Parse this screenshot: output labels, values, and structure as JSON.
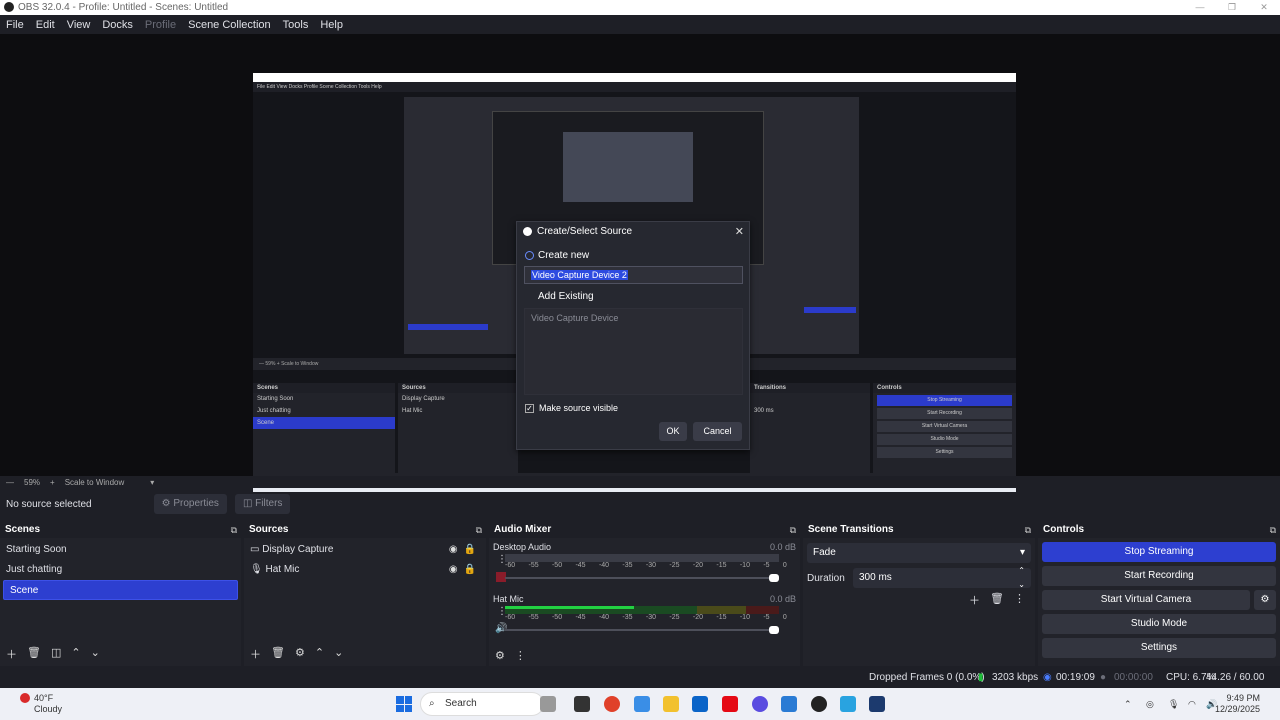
{
  "window": {
    "title": "OBS 32.0.4 - Profile: Untitled - Scenes: Untitled",
    "controls": [
      "—",
      "❐",
      "✕"
    ]
  },
  "menubar": {
    "items": [
      "File",
      "Edit",
      "View",
      "Docks",
      "Profile",
      "Scene Collection",
      "Tools",
      "Help"
    ]
  },
  "preview_nested": {
    "menu": "File  Edit  View  Docks  Profile  Scene Collection  Tools  Help",
    "zoom_row": "—  59%  +  Scale to Window",
    "no_source": "No source selected",
    "properties": "Properties",
    "filters": "Filters",
    "scenes_header": "Scenes",
    "scenes": [
      "Starting Soon",
      "Just chatting",
      "Scene"
    ],
    "sources_header": "Sources",
    "sources": [
      "Display Capture",
      "Hat Mic"
    ],
    "transitions_header": "Transitions",
    "duration": "300 ms",
    "controls_header": "Controls",
    "controls": [
      "Stop Streaming",
      "Start Recording",
      "Start Virtual Camera",
      "Studio Mode",
      "Settings"
    ],
    "status": "Dropped Frames 0 (0.0%)   3203 kbps   00:19:09   00:00:00   CPU: 6.7%   44.26 / 60.00 FPS",
    "nested_dialog_items": [
      "Create/Select Source",
      "Create new",
      "Video Capture Device 2",
      "Add Existing"
    ]
  },
  "dialog": {
    "title": "Create/Select Source",
    "close": "✕",
    "create_new": "Create new",
    "name_value": "Video Capture Device 2",
    "add_existing": "Add Existing",
    "existing_items": [
      "Video Capture Device"
    ],
    "make_visible": "Make source visible",
    "ok": "OK",
    "cancel": "Cancel"
  },
  "zoombar": {
    "minus": "—",
    "zoom": "59%",
    "plus": "+",
    "scale": "Scale to Window"
  },
  "context": {
    "status": "No source selected",
    "properties": "Properties",
    "filters": "Filters"
  },
  "scenes": {
    "header": "Scenes",
    "items": [
      "Starting Soon",
      "Just chatting",
      "Scene"
    ],
    "selected_index": 2
  },
  "sources": {
    "header": "Sources",
    "items": [
      {
        "label": "Display Capture",
        "icon": "monitor-icon"
      },
      {
        "label": "Hat Mic",
        "icon": "mic-icon"
      }
    ]
  },
  "audio_mixer": {
    "header": "Audio Mixer",
    "channels": [
      {
        "name": "Desktop Audio",
        "db": "0.0 dB",
        "level_percent": 0,
        "fader_percent": 100,
        "muted": true
      },
      {
        "name": "Hat Mic",
        "db": "0.0 dB",
        "level_percent": 47,
        "fader_percent": 100,
        "muted": false
      }
    ],
    "ticks": [
      "-60",
      "-55",
      "-50",
      "-45",
      "-40",
      "-35",
      "-30",
      "-25",
      "-20",
      "-15",
      "-10",
      "-5",
      "0"
    ]
  },
  "transitions": {
    "header": "Scene Transitions",
    "selected": "Fade",
    "duration_label": "Duration",
    "duration_value": "300 ms"
  },
  "controls": {
    "header": "Controls",
    "stop_streaming": "Stop Streaming",
    "start_recording": "Start Recording",
    "start_virtual_camera": "Start Virtual Camera",
    "studio_mode": "Studio Mode",
    "settings": "Settings"
  },
  "statusbar": {
    "dropped_frames": "Dropped Frames 0 (0.0%)",
    "bitrate": "3203 kbps",
    "stream_time": "00:19:09",
    "record_time": "00:00:00",
    "cpu": "CPU: 6.7%",
    "fps": "44.26 / 60.00 FPS"
  },
  "taskbar": {
    "temperature": "40°F",
    "weather": "Cloudy",
    "search": "Search",
    "time": "9:49 PM",
    "date": "12/29/2025"
  },
  "colors": {
    "accent": "#2d3fd0",
    "background": "#1e1f26",
    "panel": "#22232a"
  }
}
